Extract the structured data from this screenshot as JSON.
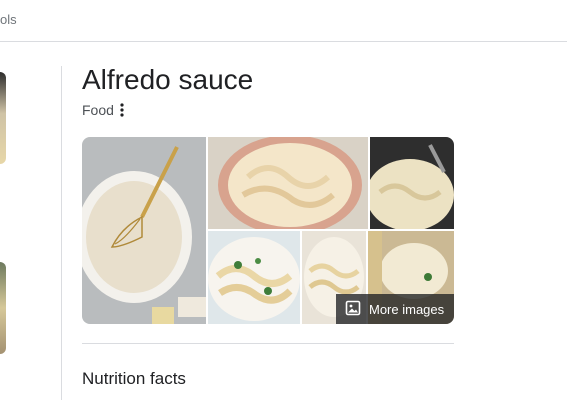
{
  "topbar": {
    "tools_fragment": "ols"
  },
  "knowledge_panel": {
    "title": "Alfredo sauce",
    "category": "Food",
    "images": [
      {
        "desc": "whisk in creamy sauce pan",
        "icon": "food-photo"
      },
      {
        "desc": "fettuccine alfredo in bowl",
        "icon": "food-photo"
      },
      {
        "desc": "pasta in skillet",
        "icon": "food-photo"
      },
      {
        "desc": "pasta with basil",
        "icon": "food-photo"
      },
      {
        "desc": "pasta on plate",
        "icon": "food-photo"
      },
      {
        "desc": "sauce in bowl",
        "icon": "food-photo"
      }
    ],
    "more_images_label": "More images",
    "section_heading": "Nutrition facts"
  },
  "colors": {
    "text": "#202124",
    "muted": "#70757a",
    "divider": "#dadce0",
    "overlay": "#202124"
  }
}
